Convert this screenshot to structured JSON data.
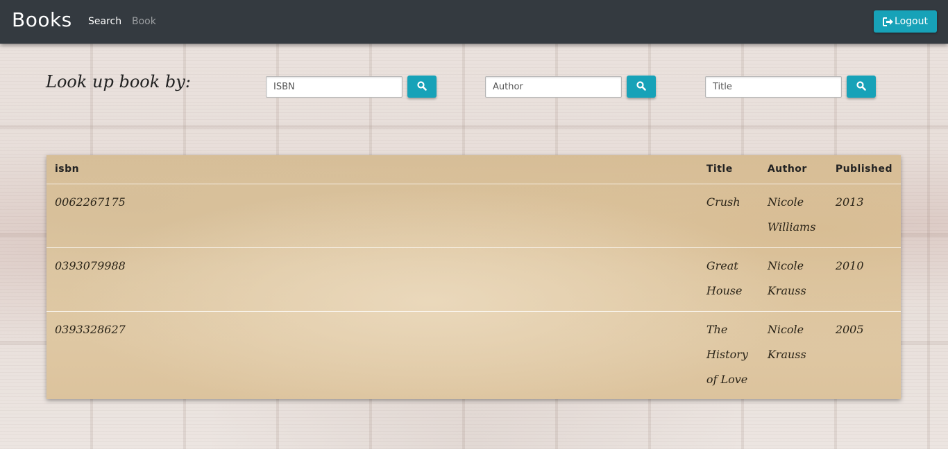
{
  "navbar": {
    "brand": "Books",
    "links": [
      "Search",
      "Book"
    ],
    "logout_label": "Logout"
  },
  "lookup": {
    "label": "Look up book by:",
    "isbn_placeholder": "ISBN",
    "author_placeholder": "Author",
    "title_placeholder": "Title"
  },
  "table": {
    "headers": [
      "isbn",
      "Title",
      "Author",
      "Published"
    ],
    "rows": [
      {
        "isbn": "0062267175",
        "title": "Crush",
        "author": "Nicole Williams",
        "published": "2013"
      },
      {
        "isbn": "0393079988",
        "title": "Great House",
        "author": "Nicole Krauss",
        "published": "2010"
      },
      {
        "isbn": "0393328627",
        "title": "The History of Love",
        "author": "Nicole Krauss",
        "published": "2005"
      }
    ]
  },
  "colors": {
    "navbar": "#343a40",
    "accent": "#17a2b8"
  },
  "icons": {
    "logout": "sign-out-icon",
    "search": "search-icon"
  }
}
